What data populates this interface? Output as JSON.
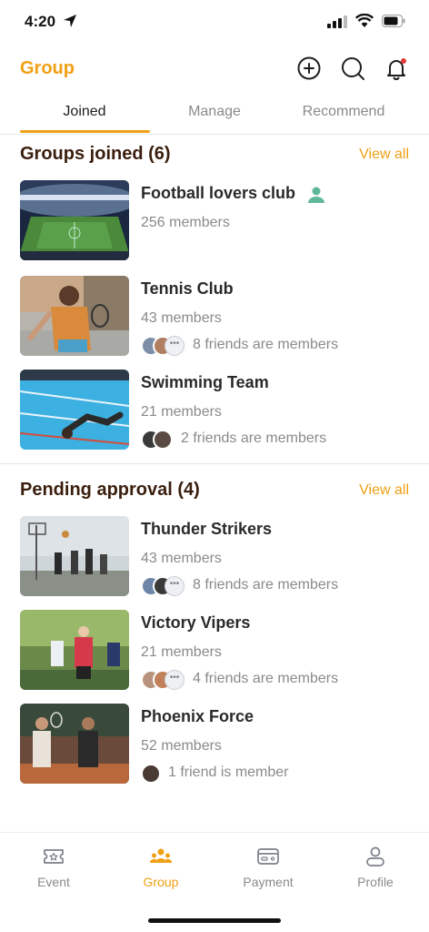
{
  "status_bar": {
    "time": "4:20"
  },
  "header": {
    "title": "Group"
  },
  "tabs": [
    {
      "label": "Joined",
      "active": true
    },
    {
      "label": "Manage",
      "active": false
    },
    {
      "label": "Recommend",
      "active": false
    }
  ],
  "joined": {
    "title": "Groups joined (6)",
    "view_all": "View all",
    "groups": [
      {
        "name": "Football lovers club",
        "members": "256 members",
        "friends": "",
        "badge_icon": "person-icon"
      },
      {
        "name": "Tennis Club",
        "members": "43 members",
        "friends": "8 friends are members"
      },
      {
        "name": "Swimming Team",
        "members": "21 members",
        "friends": "2 friends are members"
      }
    ]
  },
  "pending": {
    "title": "Pending approval (4)",
    "view_all": "View all",
    "groups": [
      {
        "name": "Thunder Strikers",
        "members": "43 members",
        "friends": "8 friends are members"
      },
      {
        "name": "Victory Vipers",
        "members": "21 members",
        "friends": "4 friends are members"
      },
      {
        "name": "Phoenix Force",
        "members": "52 members",
        "friends": "1 friend is member"
      }
    ]
  },
  "nav": [
    {
      "label": "Event",
      "icon": "ticket-icon",
      "active": false
    },
    {
      "label": "Group",
      "icon": "group-icon",
      "active": true
    },
    {
      "label": "Payment",
      "icon": "card-icon",
      "active": false
    },
    {
      "label": "Profile",
      "icon": "profile-icon",
      "active": false
    }
  ],
  "colors": {
    "accent": "#f0a014",
    "section_title": "#3a1e0e",
    "muted": "#8a8a8a",
    "notification_dot": "#e53935",
    "badge_green": "#5fb89a"
  }
}
